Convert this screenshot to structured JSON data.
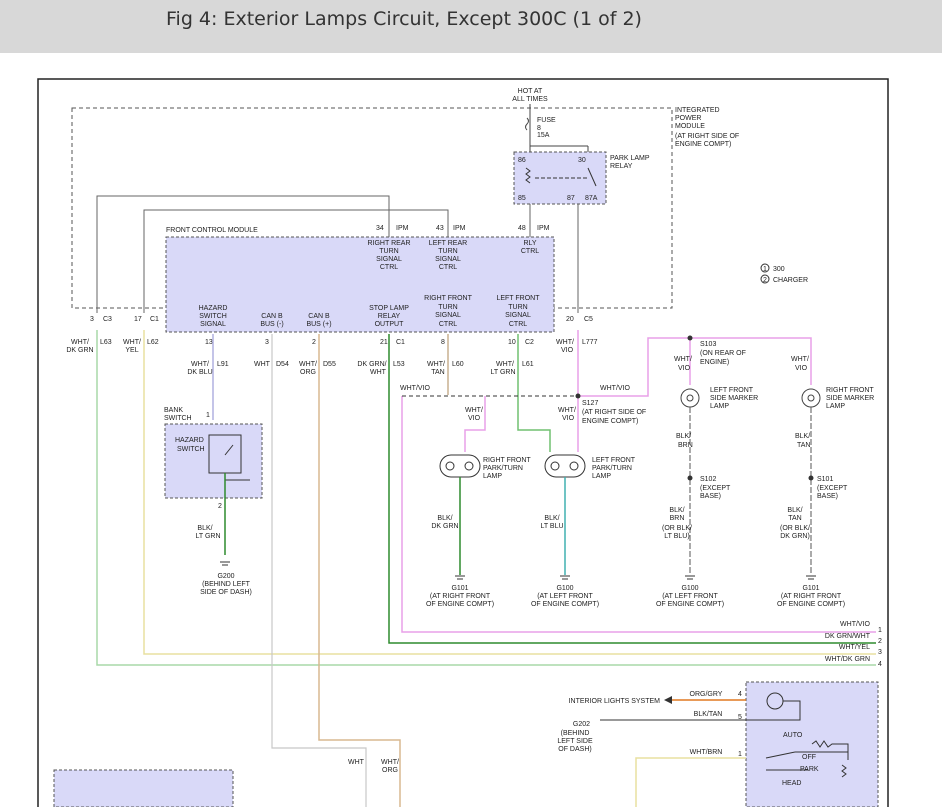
{
  "header": {
    "title": "Fig 4: Exterior Lamps Circuit, Except 300C (1 of 2)"
  },
  "hot": [
    "HOT AT",
    "ALL TIMES"
  ],
  "fuse": [
    "FUSE",
    "8",
    "15A"
  ],
  "ipm": [
    "INTEGRATED",
    "POWER",
    "MODULE",
    "(AT RIGHT SIDE OF",
    "ENGINE COMPT)"
  ],
  "relay": {
    "label": [
      "PARK LAMP",
      "RELAY"
    ],
    "pins": [
      "86",
      "30",
      "85",
      "87",
      "87A"
    ]
  },
  "fcm": {
    "title": "FRONT CONTROL MODULE",
    "top_pins": [
      "34",
      "IPM",
      "43",
      "IPM",
      "48",
      "IPM"
    ],
    "top_labels": [
      [
        "RIGHT REAR",
        "TURN",
        "SIGNAL",
        "CTRL"
      ],
      [
        "LEFT REAR",
        "TURN",
        "SIGNAL",
        "CTRL"
      ],
      [
        "RLY",
        "CTRL"
      ]
    ],
    "bottom_labels": [
      [
        "HAZARD",
        "SWITCH",
        "SIGNAL"
      ],
      [
        "CAN B",
        "BUS (-)"
      ],
      [
        "CAN B",
        "BUS (+)"
      ],
      [
        "STOP LAMP",
        "RELAY",
        "OUTPUT"
      ],
      [
        "RIGHT FRONT",
        "TURN",
        "SIGNAL",
        "CTRL"
      ],
      [
        "LEFT FRONT",
        "TURN",
        "SIGNAL",
        "CTRL"
      ]
    ],
    "bottom_pins": [
      "13",
      "3",
      "2",
      "21",
      "C1",
      "8",
      "10",
      "C2"
    ]
  },
  "left_pins": [
    "3",
    "C3",
    "17",
    "C1"
  ],
  "pin20": [
    "20",
    "C5"
  ],
  "wires": {
    "w1": [
      "WHT/",
      "DK GRN"
    ],
    "w1c": "L63",
    "w2": [
      "WHT/",
      "YEL"
    ],
    "w2c": "L62",
    "w3": [
      "WHT/",
      "DK BLU"
    ],
    "w3c": "L91",
    "w4": "WHT",
    "w4c": "D54",
    "w5": [
      "WHT/",
      "ORG"
    ],
    "w5c": "D55",
    "w6": [
      "DK GRN/",
      "WHT"
    ],
    "w6c": "L53",
    "w7": [
      "WHT/",
      "TAN"
    ],
    "w7c": "L60",
    "w8": [
      "WHT/",
      "LT GRN"
    ],
    "w8c": "L61",
    "w9": [
      "WHT/",
      "VIO"
    ],
    "w9c": "L777"
  },
  "legend": [
    {
      "num": "1",
      "text": "300"
    },
    {
      "num": "2",
      "text": "CHARGER"
    }
  ],
  "bank": [
    "BANK",
    "SWITCH"
  ],
  "hazard": [
    "HAZARD",
    "SWITCH"
  ],
  "g200": {
    "wire": [
      "BLK/",
      "LT GRN"
    ],
    "ground": "G200",
    "loc": [
      "(BEHIND LEFT",
      "SIDE OF DASH)"
    ]
  },
  "s127": [
    "S127",
    "(AT RIGHT SIDE OF",
    "ENGINE COMPT)"
  ],
  "s103": [
    "S103",
    "(ON REAR OF",
    "ENGINE)"
  ],
  "whtvio": "WHT/VIO",
  "rfp": [
    "RIGHT FRONT",
    "PARK/TURN",
    "LAMP"
  ],
  "lfp": [
    "LEFT FRONT",
    "PARK/TURN",
    "LAMP"
  ],
  "lfsm": [
    "LEFT FRONT",
    "SIDE MARKER",
    "LAMP"
  ],
  "rfsm": [
    "RIGHT FRONT",
    "SIDE MARKER",
    "LAMP"
  ],
  "grounds": [
    {
      "wire": [
        "BLK/",
        "DK GRN"
      ],
      "g": "G101",
      "loc": [
        "(AT RIGHT FRONT",
        "OF ENGINE COMPT)"
      ]
    },
    {
      "wire": [
        "BLK/",
        "LT BLU"
      ],
      "g": "G100",
      "loc": [
        "(AT LEFT FRONT",
        "OF ENGINE COMPT)"
      ]
    },
    {
      "wire": [
        "BLK/",
        "BRN",
        "(OR BLK/",
        "LT BLU)"
      ],
      "g": "G100",
      "loc": [
        "(AT LEFT FRONT",
        "OF ENGINE COMPT)"
      ]
    },
    {
      "wire": [
        "BLK/",
        "TAN",
        "(OR BLK/",
        "DK GRN)"
      ],
      "g": "G101",
      "loc": [
        "(AT RIGHT FRONT",
        "OF ENGINE COMPT)"
      ]
    }
  ],
  "s102": [
    "S102",
    "(EXCEPT",
    "BASE)"
  ],
  "s101": [
    "S101",
    "(EXCEPT",
    "BASE)"
  ],
  "blkbrn": [
    "BLK/",
    "BRN"
  ],
  "blktan": [
    "BLK/",
    "TAN"
  ],
  "bus": [
    {
      "label": "WHT/VIO",
      "num": "1"
    },
    {
      "label": "DK GRN/WHT",
      "num": "2"
    },
    {
      "label": "WHT/YEL",
      "num": "3"
    },
    {
      "label": "WHT/DK GRN",
      "num": "4"
    }
  ],
  "headlamp": {
    "interior": "INTERIOR LIGHTS SYSTEM",
    "orggry": "ORG/GRY",
    "blktan": "BLK/TAN",
    "whtbrn": "WHT/BRN",
    "g202": "G202",
    "g202loc": [
      "(BEHIND",
      "LEFT SIDE",
      "OF DASH)"
    ],
    "pins": [
      "4",
      "5",
      "1"
    ],
    "auto": "AUTO",
    "off": "OFF",
    "park": "PARK",
    "head": "HEAD"
  },
  "bottom_wires": {
    "a": "WHT",
    "b": [
      "WHT/",
      "ORG"
    ]
  },
  "colors": {
    "vio": "#e8a0e8",
    "dkgrn": "#2e8b2e",
    "yel": "#e8e0a0",
    "dkgrnwht": "#90c890",
    "orange": "#e07820",
    "blu": "#a0a0e0",
    "ltgrn": "#70c070",
    "tan": "#d8b890"
  }
}
